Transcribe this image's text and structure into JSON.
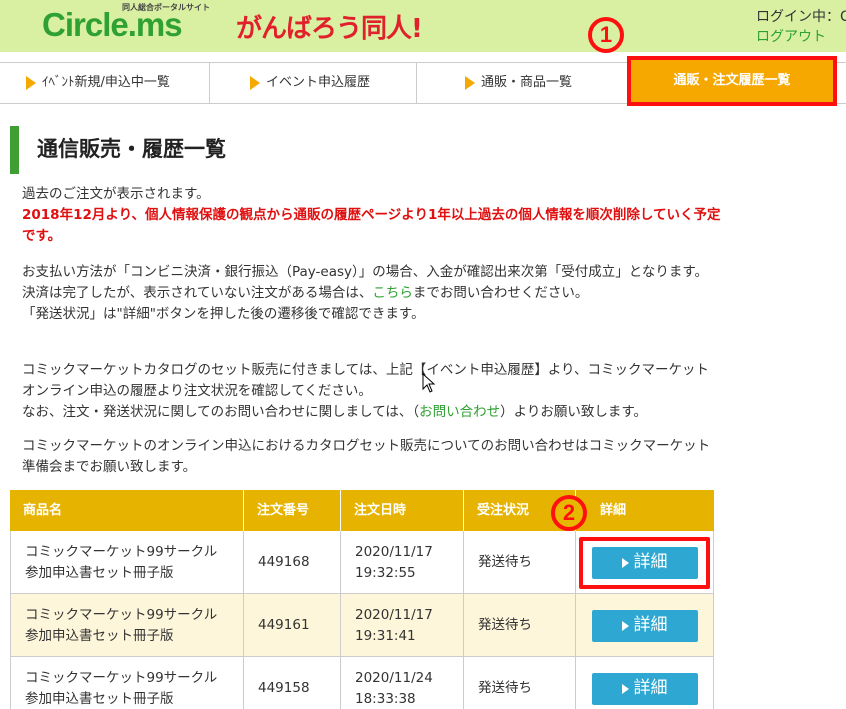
{
  "header": {
    "logo": "Circle.ms",
    "logo_sub": "同人総合ポータルサイト",
    "brand": "がんばろう同人!",
    "login_status": "ログイン中：C",
    "logout": "ログアウト"
  },
  "tabs": [
    {
      "label": "ｲﾍﾞﾝﾄ新規/申込中一覧"
    },
    {
      "label": "イベント申込履歴"
    },
    {
      "label": "通販・商品一覧"
    },
    {
      "label": "通販・注文履歴一覧"
    }
  ],
  "annotations": {
    "num1": "1",
    "num2": "2"
  },
  "page": {
    "title": "通信販売・履歴一覧",
    "intro": "過去のご注文が表示されます。",
    "warning": "2018年12月より、個人情報保護の観点から通販の履歴ページより1年以上過去の個人情報を順次削除していく予定です。",
    "p2a": "お支払い方法が「コンビニ決済・銀行振込（Pay-easy）」の場合、入金が確認出来次第「受付成立」となります。",
    "p2b_pre": "決済は完了したが、表示されていない注文がある場合は、",
    "p2b_link": "こちら",
    "p2b_post": "までお問い合わせください。",
    "p2c": "「発送状況」は\"詳細\"ボタンを押した後の遷移後で確認できます。",
    "p3a": "コミックマーケットカタログのセット販売に付きましては、上記【イベント申込履歴】より、コミックマーケットオンライン申込の履歴より注文状況を確認してください。",
    "p3b_pre": "なお、注文・発送状況に関してのお問い合わせに関しましては、（",
    "p3b_link": "お問い合わせ",
    "p3b_post": "）よりお願い致します。",
    "p4": "コミックマーケットのオンライン申込におけるカタログセット販売についてのお問い合わせはコミックマーケット準備会までお願い致します。"
  },
  "table": {
    "headers": [
      "商品名",
      "注文番号",
      "注文日時",
      "受注状況",
      "詳細"
    ],
    "rows": [
      {
        "product_line1": "コミックマーケット99サークル",
        "product_line2": "参加申込書セット冊子版",
        "order_no": "449168",
        "date": "2020/11/17",
        "time": "19:32:55",
        "status": "発送待ち",
        "button": "詳細"
      },
      {
        "product_line1": "コミックマーケット99サークル",
        "product_line2": "参加申込書セット冊子版",
        "order_no": "449161",
        "date": "2020/11/17",
        "time": "19:31:41",
        "status": "発送待ち",
        "button": "詳細"
      },
      {
        "product_line1": "コミックマーケット99サークル",
        "product_line2": "参加申込書セット冊子版",
        "order_no": "449158",
        "date": "2020/11/24",
        "time": "18:33:38",
        "status": "発送待ち",
        "button": "詳細"
      }
    ]
  },
  "colors": {
    "header_bg": "#d9f0a3",
    "logo_green": "#2fa032",
    "brand_red": "#e0202a",
    "tab_active": "#f6a800",
    "table_header": "#e6b400",
    "button_blue": "#2ea8d2",
    "highlight_red": "#ff1010"
  }
}
